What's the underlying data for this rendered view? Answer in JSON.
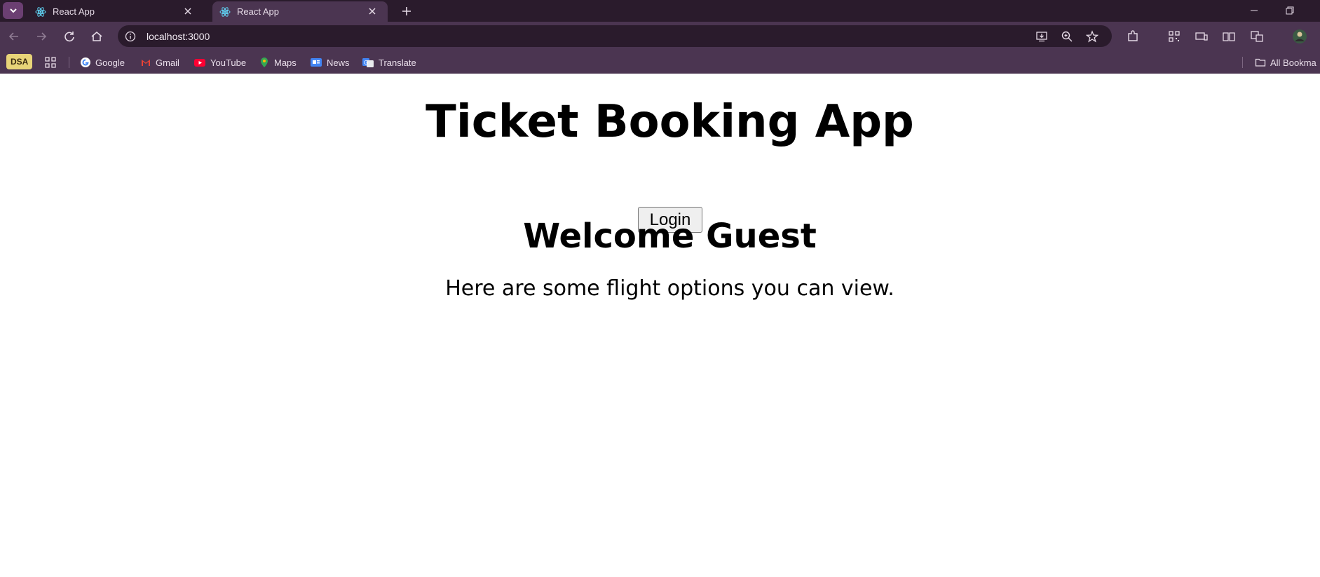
{
  "browser": {
    "tabs": [
      {
        "title": "React App",
        "active": false
      },
      {
        "title": "React App",
        "active": true
      }
    ],
    "url": "localhost:3000",
    "bookmarks": {
      "dsa_label": "DSA",
      "items": [
        {
          "label": "Google",
          "icon": "google-icon"
        },
        {
          "label": "Gmail",
          "icon": "gmail-icon"
        },
        {
          "label": "YouTube",
          "icon": "youtube-icon"
        },
        {
          "label": "Maps",
          "icon": "maps-icon"
        },
        {
          "label": "News",
          "icon": "news-icon"
        },
        {
          "label": "Translate",
          "icon": "translate-icon"
        }
      ],
      "all_bookmarks_label": "All Bookma"
    },
    "colors": {
      "tabbar": "#2a1b2c",
      "toolbar": "#4b3551",
      "accent": "#6b3f72"
    }
  },
  "page": {
    "title": "Ticket Booking App",
    "login_button": "Login",
    "welcome": "Welcome Guest",
    "subtext": "Here are some flight options you can view."
  }
}
